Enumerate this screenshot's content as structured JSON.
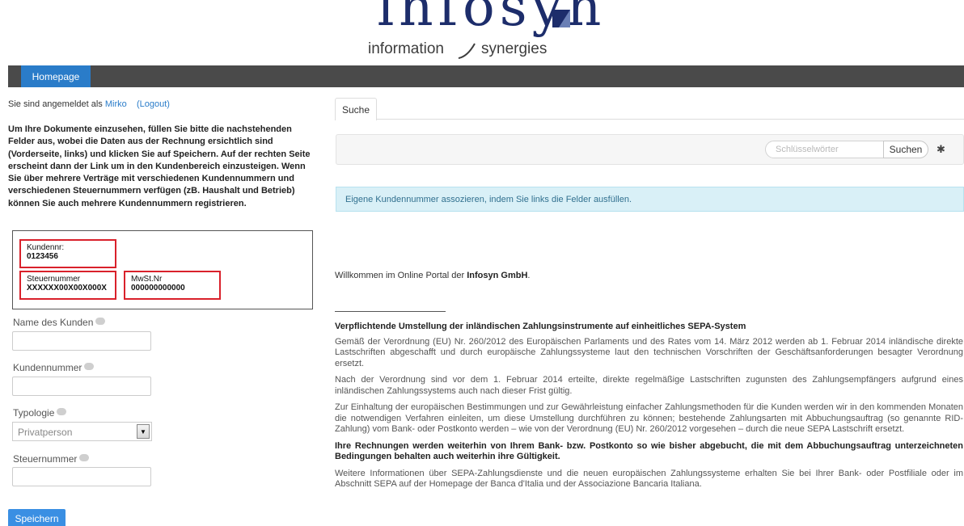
{
  "logo": {
    "word": "infosyn",
    "tagline_left": "information",
    "tagline_right": "synergies"
  },
  "nav": {
    "homepage": "Homepage"
  },
  "session": {
    "prefix": "Sie sind angemeldet als",
    "user": "Mirko",
    "logout": "(Logout)"
  },
  "intro_text": "Um Ihre Dokumente einzusehen, füllen Sie bitte die nachstehenden Felder aus, wobei die Daten aus der Rechnung ersichtlich sind (Vorderseite, links) und klicken Sie auf Speichern. Auf der rechten Seite erscheint dann der Link um in den Kundenbereich einzusteigen. Wenn Sie über mehrere Verträge mit verschiedenen Kundennummern und verschiedenen Steuernummern verfügen (zB. Haushalt und Betrieb) können Sie auch mehrere Kundennummern registrieren.",
  "example": {
    "kundennr_label": "Kundennr:",
    "kundennr_value": "0123456",
    "steuernummer_label": "Steuernummer",
    "steuernummer_value": "XXXXXX00X00X000X",
    "mwst_label": "MwSt.Nr",
    "mwst_value": "000000000000"
  },
  "form": {
    "name_label": "Name des Kunden",
    "name_value": "",
    "kundennummer_label": "Kundennummer",
    "kundennummer_value": "",
    "typologie_label": "Typologie",
    "typologie_value": "Privatperson",
    "steuernummer_label": "Steuernummer",
    "steuernummer_value": "",
    "save": "Speichern"
  },
  "tabs": [
    {
      "label": "Suche",
      "active": true
    }
  ],
  "search": {
    "placeholder": "Schlüsselwörter",
    "button": "Suchen"
  },
  "alert": "Eigene Kundennummer assozieren, indem Sie links die Felder ausfüllen.",
  "welcome": {
    "prefix": "Willkommen im Online Portal der",
    "company": "Infosyn GmbH",
    "suffix": "."
  },
  "article": {
    "heading": "Verpflichtende Umstellung der inländischen Zahlungsinstrumente auf einheitliches SEPA-System",
    "p1": "Gemäß der Verordnung (EU) Nr. 260/2012 des Europäischen Parlaments und des Rates vom 14. März 2012 werden ab 1. Februar 2014 inländische direkte Lastschriften abgeschafft und durch europäische Zahlungssysteme laut den technischen Vorschriften der Geschäftsanforderungen besagter Verordnung ersetzt.",
    "p2": "Nach der Verordnung sind vor dem 1. Februar 2014 erteilte, direkte regelmäßige Lastschriften zugunsten des Zahlungsempfängers aufgrund eines inländischen Zahlungssystems auch nach dieser Frist gültig.",
    "p3": "Zur Einhaltung der europäischen Bestimmungen und zur Gewährleistung einfacher Zahlungsmethoden für die Kunden werden wir in den kommenden Monaten die notwendigen Verfahren einleiten, um diese Umstellung durchführen zu können; bestehende Zahlungsarten mit Abbuchungsauftrag (so genannte RID-Zahlung) vom Bank- oder Postkonto werden – wie von der Verordnung (EU) Nr. 260/2012 vorgesehen – durch die neue SEPA Lastschrift ersetzt.",
    "p4": "Ihre Rechnungen werden weiterhin von Ihrem Bank- bzw. Postkonto so wie bisher abgebucht, die mit dem Abbuchungsauftrag unterzeichneten Bedingungen behalten auch weiterhin ihre Gültigkeit.",
    "p5": "Weitere Informationen über SEPA-Zahlungsdienste und die neuen europäischen Zahlungssysteme erhalten Sie bei Ihrer Bank- oder Postfiliale oder im Abschnitt SEPA auf der Homepage der Banca d'Italia und der Associazione Bancaria Italiana."
  },
  "colors": {
    "brand_navy": "#1d2d6b",
    "accent_blue": "#2a7cc9",
    "nav_bg": "#4a4a4a",
    "highlight_red": "#d9212b",
    "alert_bg": "#d9f0f7"
  },
  "icons": {
    "info": "speech-bubble-icon",
    "gear": "gear-icon",
    "select_arrow": "triangle-down-icon"
  }
}
